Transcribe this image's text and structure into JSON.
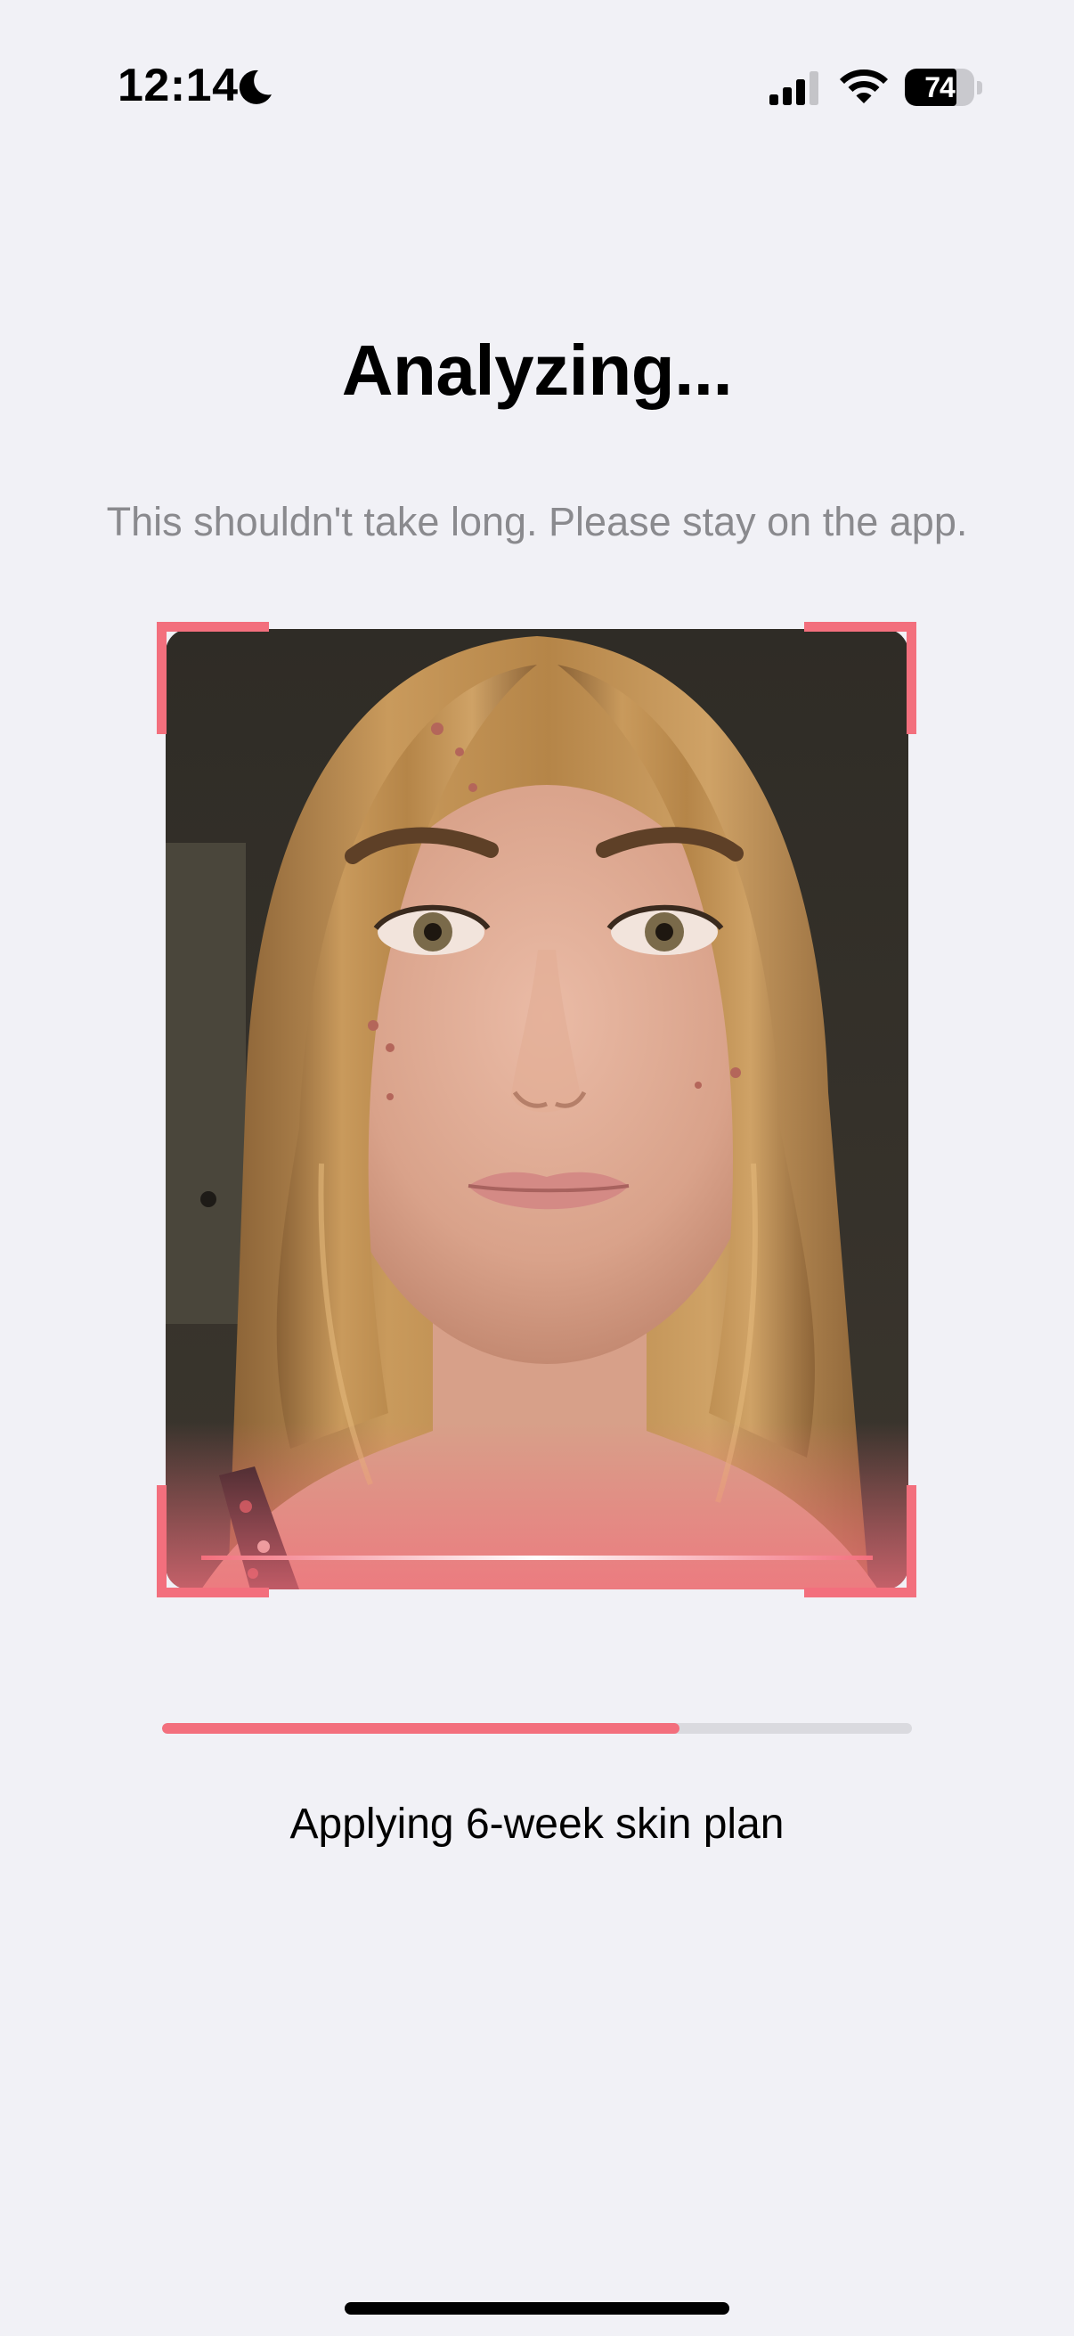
{
  "status_bar": {
    "time": "12:14",
    "battery_percent": "74",
    "battery_level": 0.74,
    "icons": [
      "moon-icon",
      "cellular-signal-icon",
      "wifi-icon",
      "battery-icon"
    ]
  },
  "screen": {
    "title": "Analyzing...",
    "subtitle": "This shouldn't take long. Please stay on the app."
  },
  "photo": {
    "subject": "face-selfie-photo",
    "accent_color": "#F36F7D"
  },
  "progress": {
    "value": 0.69,
    "label": "Applying 6-week skin plan",
    "fill_color": "#F36F7D",
    "track_color": "#DADADF"
  }
}
